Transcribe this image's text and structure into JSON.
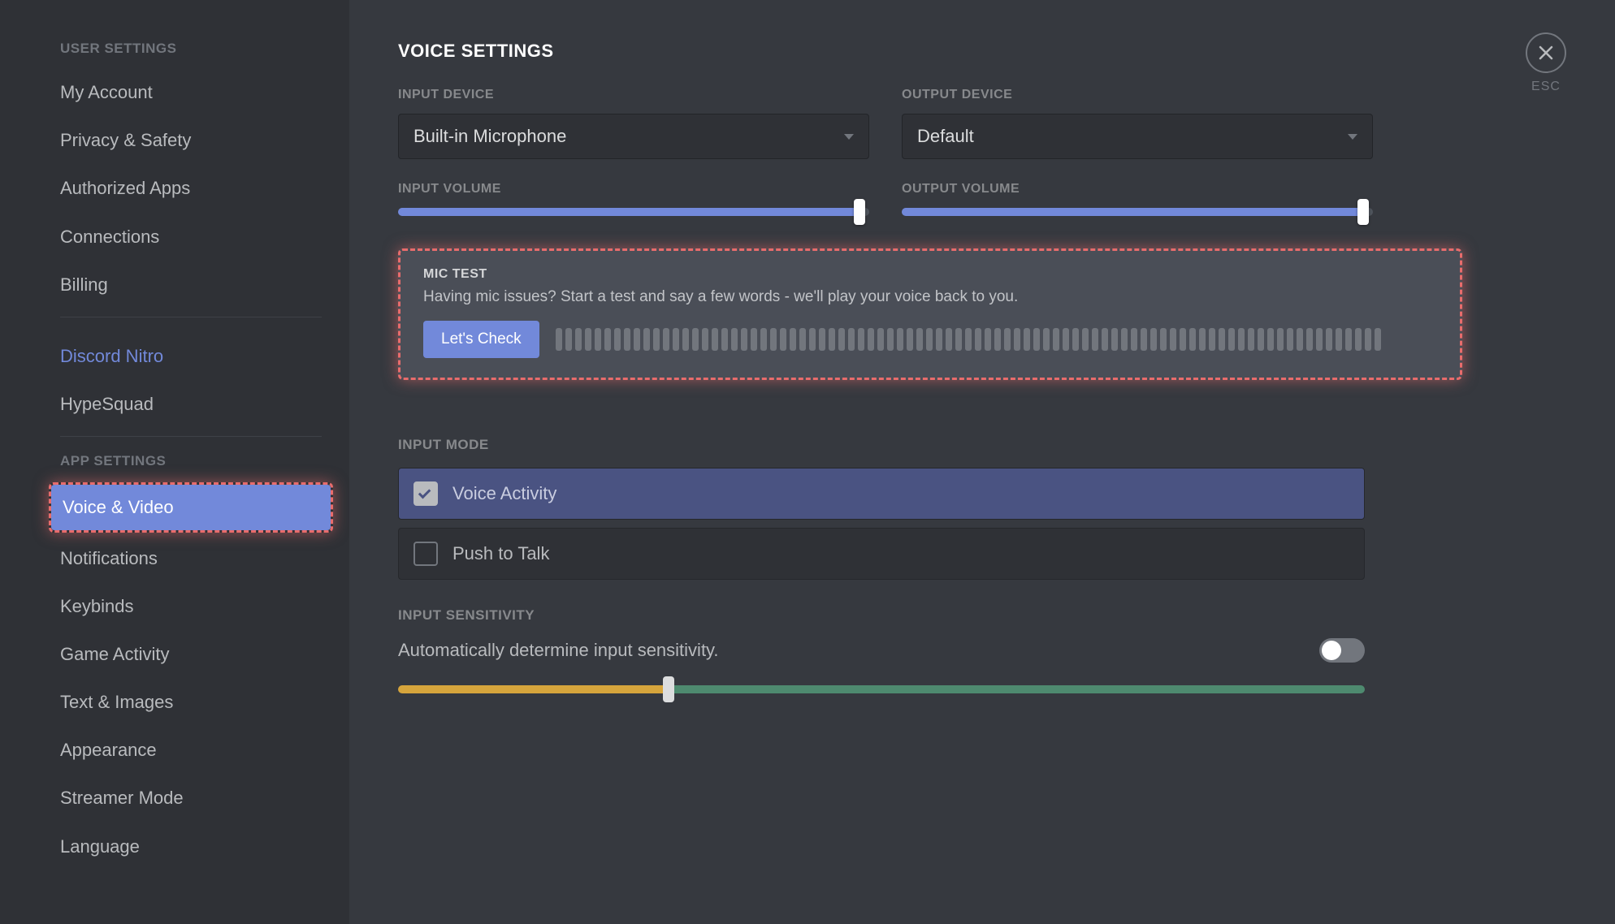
{
  "sidebar": {
    "section1_header": "USER SETTINGS",
    "section2_header": "APP SETTINGS",
    "items1": [
      {
        "label": "My Account"
      },
      {
        "label": "Privacy & Safety"
      },
      {
        "label": "Authorized Apps"
      },
      {
        "label": "Connections"
      },
      {
        "label": "Billing"
      }
    ],
    "items1b": [
      {
        "label": "Discord Nitro",
        "nitro": true
      },
      {
        "label": "HypeSquad"
      }
    ],
    "items2": [
      {
        "label": "Voice & Video",
        "active": true,
        "highlighted": true
      },
      {
        "label": "Notifications"
      },
      {
        "label": "Keybinds"
      },
      {
        "label": "Game Activity"
      },
      {
        "label": "Text & Images"
      },
      {
        "label": "Appearance"
      },
      {
        "label": "Streamer Mode"
      },
      {
        "label": "Language"
      }
    ]
  },
  "close": {
    "esc": "ESC"
  },
  "main": {
    "title": "VOICE SETTINGS",
    "inputDeviceLabel": "INPUT DEVICE",
    "inputDevice": "Built-in Microphone",
    "outputDeviceLabel": "OUTPUT DEVICE",
    "outputDevice": "Default",
    "inputVolumeLabel": "INPUT VOLUME",
    "inputVolume": 98,
    "outputVolumeLabel": "OUTPUT VOLUME",
    "outputVolume": 98,
    "micTest": {
      "title": "MIC TEST",
      "desc": "Having mic issues? Start a test and say a few words - we'll play your voice back to you.",
      "button": "Let's Check"
    },
    "inputModeLabel": "INPUT MODE",
    "inputModes": [
      {
        "label": "Voice Activity",
        "selected": true
      },
      {
        "label": "Push to Talk",
        "selected": false
      }
    ],
    "inputSensLabel": "INPUT SENSITIVITY",
    "inputSensDesc": "Automatically determine input sensitivity.",
    "inputSensToggle": false,
    "inputSensValue": 28
  }
}
